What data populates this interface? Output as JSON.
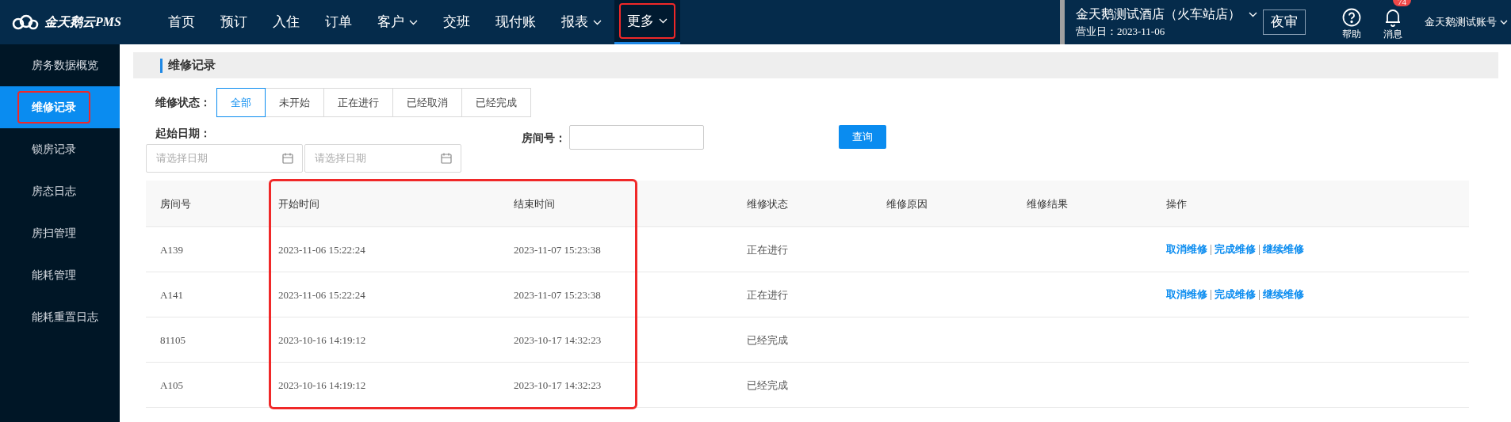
{
  "logo": {
    "text": "金天鹅云PMS"
  },
  "nav": [
    {
      "label": "首页",
      "dropdown": false,
      "selected": false,
      "annotated": false
    },
    {
      "label": "预订",
      "dropdown": false,
      "selected": false,
      "annotated": false
    },
    {
      "label": "入住",
      "dropdown": false,
      "selected": false,
      "annotated": false
    },
    {
      "label": "订单",
      "dropdown": false,
      "selected": false,
      "annotated": false
    },
    {
      "label": "客户",
      "dropdown": true,
      "selected": false,
      "annotated": false
    },
    {
      "label": "交班",
      "dropdown": false,
      "selected": false,
      "annotated": false
    },
    {
      "label": "现付账",
      "dropdown": false,
      "selected": false,
      "annotated": false
    },
    {
      "label": "报表",
      "dropdown": true,
      "selected": false,
      "annotated": false
    },
    {
      "label": "更多",
      "dropdown": true,
      "selected": true,
      "annotated": true
    }
  ],
  "hotel": {
    "name": "金天鹅测试酒店（火车站店）",
    "business_date": "营业日：2023-11-06"
  },
  "night_audit_button": "夜审",
  "help": {
    "label": "帮助"
  },
  "messages": {
    "label": "消息",
    "badge": "74"
  },
  "account": "金天鹅测试账号",
  "sidebar": {
    "items": [
      {
        "label": "房务数据概览",
        "selected": false,
        "annotated": false
      },
      {
        "label": "维修记录",
        "selected": true,
        "annotated": true
      },
      {
        "label": "锁房记录",
        "selected": false,
        "annotated": false
      },
      {
        "label": "房态日志",
        "selected": false,
        "annotated": false
      },
      {
        "label": "房扫管理",
        "selected": false,
        "annotated": false
      },
      {
        "label": "能耗管理",
        "selected": false,
        "annotated": false
      },
      {
        "label": "能耗重置日志",
        "selected": false,
        "annotated": false
      }
    ]
  },
  "page_title": "维修记录",
  "filters": {
    "status_label": "维修状态：",
    "status_options": [
      {
        "label": "全部",
        "selected": true
      },
      {
        "label": "未开始",
        "selected": false
      },
      {
        "label": "正在进行",
        "selected": false
      },
      {
        "label": "已经取消",
        "selected": false
      },
      {
        "label": "已经完成",
        "selected": false
      }
    ],
    "date_label": "起始日期：",
    "date_fields": [
      {
        "placeholder": "请选择日期"
      },
      {
        "placeholder": "请选择日期"
      }
    ],
    "room_label": "房间号：",
    "query_button": "查询"
  },
  "table": {
    "columns": [
      {
        "label": "房间号"
      },
      {
        "label": "开始时间",
        "annotated": true
      },
      {
        "label": "结束时间",
        "annotated": true
      },
      {
        "label": "维修状态"
      },
      {
        "label": "维修原因"
      },
      {
        "label": "维修结果"
      },
      {
        "label": "操作"
      }
    ],
    "rows": [
      {
        "room": "A139",
        "start": "2023-11-06 15:22:24",
        "end": "2023-11-07 15:23:38",
        "status": "正在进行",
        "actions": [
          "取消维修",
          "完成维修",
          "继续维修"
        ]
      },
      {
        "room": "A141",
        "start": "2023-11-06 15:22:24",
        "end": "2023-11-07 15:23:38",
        "status": "正在进行",
        "actions": [
          "取消维修",
          "完成维修",
          "继续维修"
        ]
      },
      {
        "room": "81105",
        "start": "2023-10-16 14:19:12",
        "end": "2023-10-17 14:32:23",
        "status": "已经完成"
      },
      {
        "room": "A105",
        "start": "2023-10-16 14:19:12",
        "end": "2023-10-17 14:32:23",
        "status": "已经完成"
      }
    ]
  }
}
